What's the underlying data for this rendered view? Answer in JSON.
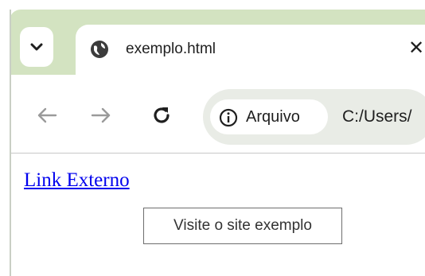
{
  "browser": {
    "tab": {
      "title": "exemplo.html",
      "favicon_icon": "globe-icon",
      "close_label": "✕"
    },
    "tab_search_icon": "chevron-down-icon",
    "nav": {
      "back_icon": "arrow-left-icon",
      "forward_icon": "arrow-right-icon",
      "reload_icon": "reload-icon"
    },
    "omnibox": {
      "security_icon": "info-icon",
      "security_label": "Arquivo",
      "url": "C:/Users/"
    },
    "colors": {
      "tabbar_bg": "#d3e3c1",
      "omnibox_bg": "#e9ece6",
      "link": "#0000ee"
    }
  },
  "page": {
    "link_text": "Link Externo",
    "tooltip_text": "Visite o site exemplo"
  }
}
